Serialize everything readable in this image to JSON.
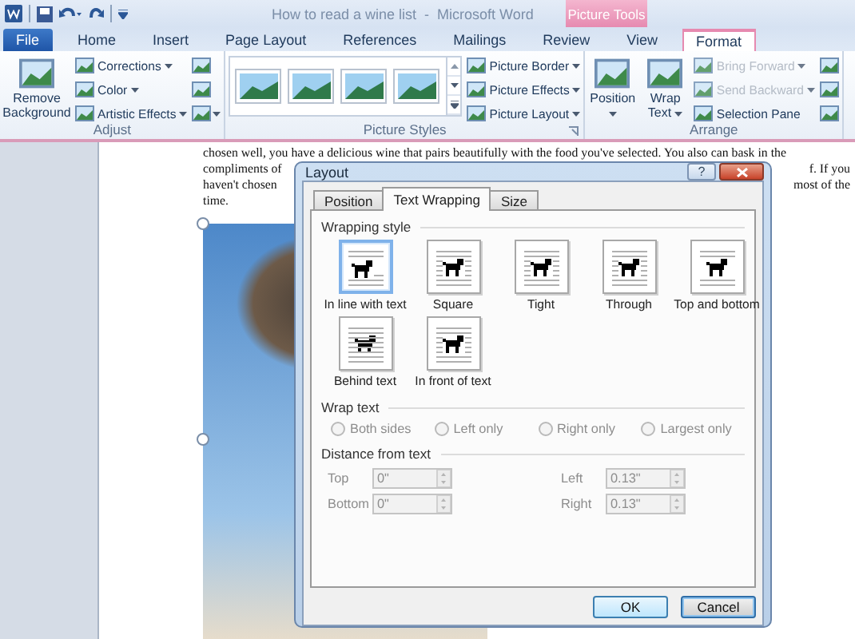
{
  "window": {
    "title": "How to read a wine list  -  Microsoft Word",
    "context_header": "Picture Tools"
  },
  "tabs": [
    {
      "label": "File",
      "kind": "file",
      "selected": false
    },
    {
      "label": "Home",
      "kind": "normal",
      "selected": false
    },
    {
      "label": "Insert",
      "kind": "normal",
      "selected": false
    },
    {
      "label": "Page Layout",
      "kind": "normal",
      "selected": false
    },
    {
      "label": "References",
      "kind": "normal",
      "selected": false
    },
    {
      "label": "Mailings",
      "kind": "normal",
      "selected": false
    },
    {
      "label": "Review",
      "kind": "normal",
      "selected": false
    },
    {
      "label": "View",
      "kind": "normal",
      "selected": false
    },
    {
      "label": "Format",
      "kind": "contextual",
      "selected": true
    }
  ],
  "ribbon": {
    "groups": [
      {
        "label": "Adjust",
        "items": [
          {
            "kind": "large",
            "label": "Remove Background"
          },
          {
            "kind": "small",
            "label": "Corrections",
            "dropdown": true
          },
          {
            "kind": "small",
            "label": "Color",
            "dropdown": true
          },
          {
            "kind": "small",
            "label": "Artistic Effects",
            "dropdown": true
          },
          {
            "kind": "icon"
          },
          {
            "kind": "icon"
          },
          {
            "kind": "icon",
            "dropdown": true
          }
        ]
      },
      {
        "label": "Picture Styles",
        "launcher": true,
        "items": [
          {
            "kind": "gallery"
          },
          {
            "kind": "small",
            "label": "Picture Border",
            "dropdown": true
          },
          {
            "kind": "small",
            "label": "Picture Effects",
            "dropdown": true
          },
          {
            "kind": "small",
            "label": "Picture Layout",
            "dropdown": true
          }
        ]
      },
      {
        "label": "Arrange",
        "items": [
          {
            "kind": "large",
            "label": "Position",
            "dropdown": true
          },
          {
            "kind": "large",
            "label": "Wrap Text",
            "dropdown": true
          },
          {
            "kind": "small",
            "label": "Bring Forward",
            "dropdown": true,
            "disabled": true
          },
          {
            "kind": "small",
            "label": "Send Backward",
            "dropdown": true,
            "disabled": true
          },
          {
            "kind": "small",
            "label": "Selection Pane"
          },
          {
            "kind": "icon"
          },
          {
            "kind": "icon"
          },
          {
            "kind": "icon"
          }
        ]
      }
    ]
  },
  "document": {
    "lines": [
      {
        "left": "chosen well, you have a delicious wine that pairs beautifully with the food you've selected. You also can bask in the"
      },
      {
        "left": "compliments of",
        "right": "f. If you"
      },
      {
        "left": "haven't chosen",
        "right": "most of the"
      },
      {
        "left": "time."
      }
    ]
  },
  "dialog": {
    "title": "Layout",
    "help": "?",
    "tabs": [
      {
        "label": "Position",
        "selected": false
      },
      {
        "label": "Text Wrapping",
        "selected": true
      },
      {
        "label": "Size",
        "selected": false
      }
    ],
    "wrapping_style": {
      "heading": "Wrapping style",
      "options": [
        {
          "label": "In line with text",
          "kind": "inline",
          "selected": true
        },
        {
          "label": "Square",
          "kind": "square",
          "selected": false
        },
        {
          "label": "Tight",
          "kind": "tight",
          "selected": false
        },
        {
          "label": "Through",
          "kind": "through",
          "selected": false
        },
        {
          "label": "Top and bottom",
          "kind": "top_bottom",
          "selected": false
        },
        {
          "label": "Behind text",
          "kind": "behind",
          "selected": false
        },
        {
          "label": "In front of text",
          "kind": "front",
          "selected": false
        }
      ]
    },
    "wrap_text": {
      "heading": "Wrap text",
      "disabled": true,
      "options": [
        {
          "label": "Both sides",
          "selected": false
        },
        {
          "label": "Left only",
          "selected": false
        },
        {
          "label": "Right only",
          "selected": false
        },
        {
          "label": "Largest only",
          "selected": false
        }
      ]
    },
    "distance": {
      "heading": "Distance from text",
      "disabled": true,
      "fields": [
        {
          "label": "Top",
          "value": "0\""
        },
        {
          "label": "Left",
          "value": "0.13\""
        },
        {
          "label": "Bottom",
          "value": "0\""
        },
        {
          "label": "Right",
          "value": "0.13\""
        }
      ]
    },
    "buttons": [
      {
        "label": "OK",
        "default": true
      },
      {
        "label": "Cancel",
        "default": false
      }
    ]
  }
}
